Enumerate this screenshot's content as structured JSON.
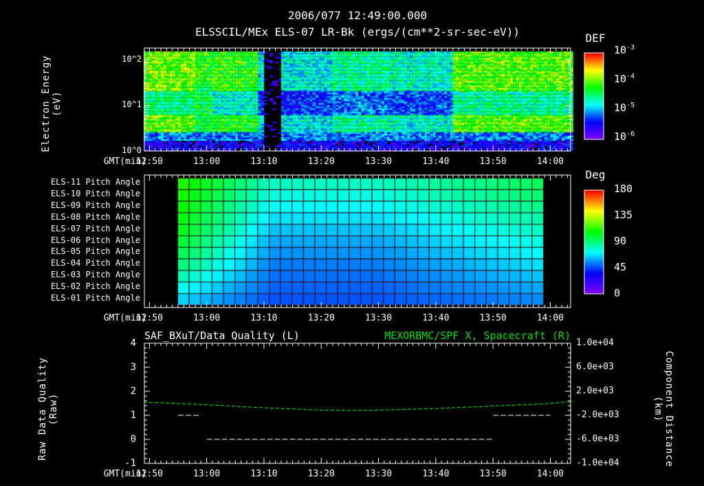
{
  "header": {
    "timestamp": "2006/077 12:49:00.000"
  },
  "chart_data": [
    {
      "type": "heatmap",
      "title": "ELSSCIL/MEx ELS-07 LR-Bk  (ergs/(cm**2-sr-sec-eV))",
      "xlabel": "GMT(min)",
      "ylabel": [
        "Electron Energy",
        "(eV)"
      ],
      "x_ticks": [
        "12:50",
        "13:00",
        "13:10",
        "13:20",
        "13:30",
        "13:40",
        "13:50",
        "14:00"
      ],
      "y_ticks": [
        "10^0",
        "10^1",
        "10^2"
      ],
      "y_scale": "log",
      "ylim": [
        1,
        180
      ],
      "colorbar": {
        "label": "DEF",
        "ticks": [
          "10^-3",
          "10^-4",
          "10^-5",
          "10^-6"
        ],
        "range": [
          1e-06,
          0.001
        ],
        "scale": "log"
      }
    },
    {
      "type": "heatmap",
      "xlabel": "GMT(min)",
      "x_ticks": [
        "12:50",
        "13:00",
        "13:10",
        "13:20",
        "13:30",
        "13:40",
        "13:50",
        "14:00"
      ],
      "rows": [
        "ELS-11 Pitch Angle",
        "ELS-10 Pitch Angle",
        "ELS-09 Pitch Angle",
        "ELS-08 Pitch Angle",
        "ELS-07 Pitch Angle",
        "ELS-06 Pitch Angle",
        "ELS-05 Pitch Angle",
        "ELS-04 Pitch Angle",
        "ELS-03 Pitch Angle",
        "ELS-02 Pitch Angle",
        "ELS-01 Pitch Angle"
      ],
      "data_range_minutes": [
        "12:55",
        "13:59"
      ],
      "start_values_deg": [
        112,
        110,
        108,
        106,
        104,
        100,
        96,
        90,
        82,
        74,
        66
      ],
      "end_values_deg": [
        95,
        92,
        88,
        84,
        80,
        76,
        72,
        68,
        64,
        60,
        56
      ],
      "mid_values_deg": [
        80,
        76,
        72,
        68,
        64,
        60,
        57,
        54,
        52,
        50,
        48
      ],
      "colorbar": {
        "label": "Deg",
        "ticks": [
          "180",
          "135",
          "90",
          "45",
          "0"
        ],
        "range": [
          0,
          180
        ]
      }
    },
    {
      "type": "line",
      "left_title": "SAF_BXuT/Data Quality (L)",
      "right_title": "MEXORBMC/SPF X, Spacecraft (R)",
      "xlabel": "GMT(min)",
      "x_ticks": [
        "12:50",
        "13:00",
        "13:10",
        "13:20",
        "13:30",
        "13:40",
        "13:50",
        "14:00"
      ],
      "ylabel_left": [
        "Raw Data Quality",
        "(Raw)"
      ],
      "ylabel_right": [
        "Component Distance",
        "(km)"
      ],
      "y_ticks_left": [
        "4",
        "3",
        "2",
        "1",
        "0",
        "-1"
      ],
      "ylim_left": [
        -1,
        4
      ],
      "y_ticks_right": [
        "1.0e+04",
        "6.0e+03",
        "2.0e+03",
        "-2.0e+03",
        "-6.0e+03",
        "-1.0e+04"
      ],
      "ylim_right": [
        -10000,
        10000
      ],
      "series": [
        {
          "name": "Data Quality",
          "axis": "left",
          "color": "#ffffff",
          "segments": [
            {
              "x": [
                6,
                10
              ],
              "y": 1
            },
            {
              "x": [
                11,
                61
              ],
              "y": 0
            },
            {
              "x": [
                61,
                71
              ],
              "y": 1
            }
          ]
        },
        {
          "name": "SPF X",
          "axis": "right",
          "color": "#00ff00",
          "style": "dashed",
          "x_minutes_from_1249": [
            0,
            10,
            20,
            30,
            36,
            40,
            50,
            60,
            70,
            75
          ],
          "y": [
            200,
            -200,
            -700,
            -1100,
            -1200,
            -1150,
            -900,
            -500,
            -100,
            300
          ]
        }
      ]
    }
  ],
  "colors": {
    "background": "#000000",
    "axis": "#ffffff",
    "spf_line": "#00ff00"
  }
}
